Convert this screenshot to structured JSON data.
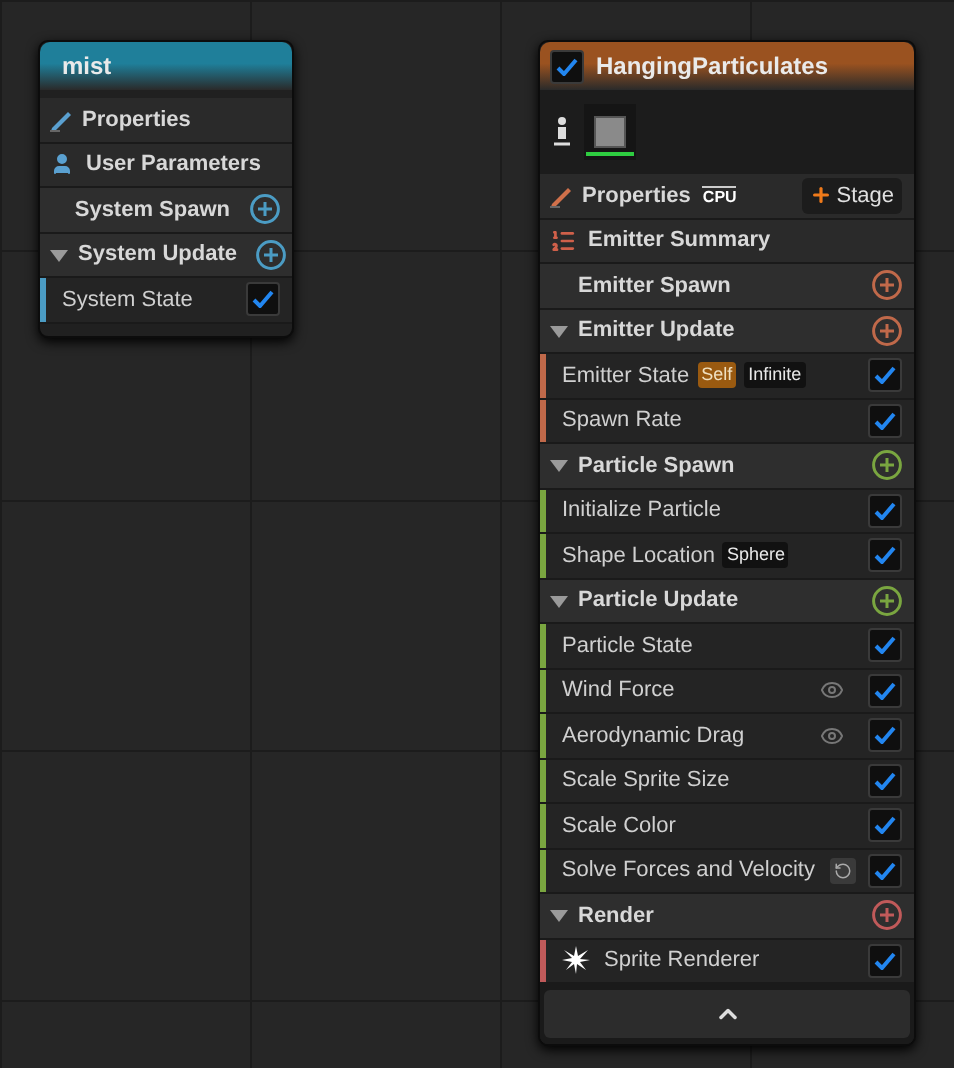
{
  "nodes": [
    {
      "title": "mist",
      "color": "#1f7f9a",
      "rows": [
        {
          "kind": "properties",
          "label": "Properties"
        },
        {
          "kind": "user_parameters",
          "label": "User Parameters"
        },
        {
          "kind": "stage",
          "label": "System Spawn",
          "color": "#4b9cc4"
        },
        {
          "kind": "stage",
          "label": "System Update",
          "expanded": true,
          "color": "#4b9cc4"
        },
        {
          "kind": "module",
          "label": "System State",
          "checked": true
        }
      ]
    },
    {
      "title": "HangingParticulates",
      "color": "#9a5220",
      "enabled": true,
      "thumbnail": true,
      "collapse_button": true,
      "rows": [
        {
          "kind": "properties",
          "label": "Properties",
          "sim_target": "CPU",
          "stage_button": "Stage"
        },
        {
          "kind": "summary",
          "label": "Emitter Summary"
        },
        {
          "kind": "stage",
          "label": "Emitter Spawn",
          "color": "#c0694a"
        },
        {
          "kind": "stage",
          "label": "Emitter Update",
          "expanded": true,
          "color": "#c0694a"
        },
        {
          "kind": "module",
          "label": "Emitter State",
          "checked": true,
          "tags": [
            {
              "text": "Self",
              "kind": "highlight"
            },
            {
              "text": "Infinite",
              "kind": "plain"
            }
          ]
        },
        {
          "kind": "module",
          "label": "Spawn Rate",
          "checked": true
        },
        {
          "kind": "stage",
          "label": "Particle Spawn",
          "expanded": true,
          "color": "#7aa640"
        },
        {
          "kind": "module",
          "label": "Initialize Particle",
          "checked": true
        },
        {
          "kind": "module",
          "label": "Shape Location",
          "checked": true,
          "tags": [
            {
              "text": "Sphere",
              "kind": "plain"
            }
          ]
        },
        {
          "kind": "stage",
          "label": "Particle Update",
          "expanded": true,
          "color": "#7aa640"
        },
        {
          "kind": "module",
          "label": "Particle State",
          "checked": true
        },
        {
          "kind": "module",
          "label": "Wind Force",
          "checked": true,
          "visibility_toggle": true
        },
        {
          "kind": "module",
          "label": "Aerodynamic Drag",
          "checked": true,
          "visibility_toggle": true
        },
        {
          "kind": "module",
          "label": "Scale Sprite Size",
          "checked": true
        },
        {
          "kind": "module",
          "label": "Scale Color",
          "checked": true
        },
        {
          "kind": "module",
          "label": "Solve Forces and Velocity",
          "checked": true,
          "reset_available": true
        },
        {
          "kind": "stage",
          "label": "Render",
          "expanded": true,
          "color": "#c05a5a"
        },
        {
          "kind": "renderer",
          "label": "Sprite Renderer",
          "checked": true
        }
      ]
    }
  ]
}
